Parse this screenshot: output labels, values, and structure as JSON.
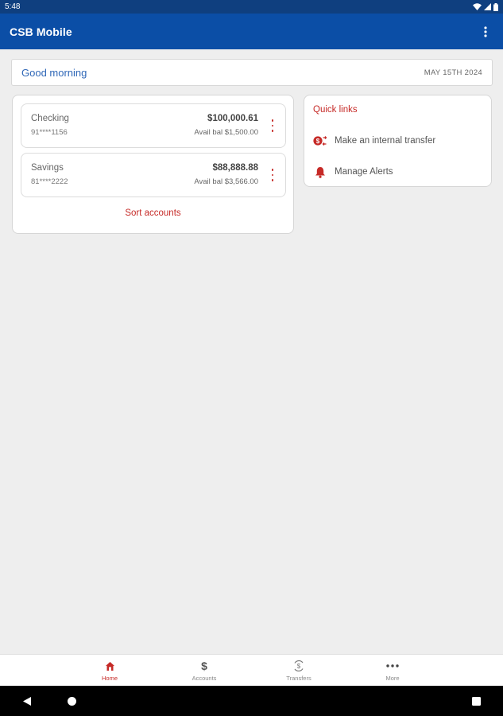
{
  "status_bar": {
    "time": "5:48",
    "icons": [
      "wifi-icon",
      "signal-icon",
      "battery-icon"
    ]
  },
  "app_bar": {
    "title": "CSB Mobile",
    "menu_icon": "more-vert-icon"
  },
  "greeting": {
    "text": "Good morning",
    "date": "MAY 15TH 2024"
  },
  "accounts": [
    {
      "name": "Checking",
      "number": "91****1156",
      "balance": "$100,000.61",
      "available": "Avail bal $1,500.00"
    },
    {
      "name": "Savings",
      "number": "81****2222",
      "balance": "$88,888.88",
      "available": "Avail bal $3,566.00"
    }
  ],
  "sort_label": "Sort accounts",
  "quick_links": {
    "title": "Quick links",
    "items": [
      {
        "label": "Make an internal transfer",
        "icon": "transfer-icon"
      },
      {
        "label": "Manage Alerts",
        "icon": "bell-icon"
      }
    ]
  },
  "bottom_nav": {
    "items": [
      {
        "label": "Home",
        "icon": "home-icon",
        "active": true
      },
      {
        "label": "Accounts",
        "icon": "dollar-icon",
        "active": false
      },
      {
        "label": "Transfers",
        "icon": "transfers-icon",
        "active": false
      },
      {
        "label": "More",
        "icon": "more-horiz-icon",
        "active": false
      }
    ]
  },
  "colors": {
    "app_bar": "#0b4ea6",
    "status_bar": "#0f3f7f",
    "accent": "#c62a27",
    "greeting": "#2f67b7",
    "background": "#eeeeee"
  }
}
